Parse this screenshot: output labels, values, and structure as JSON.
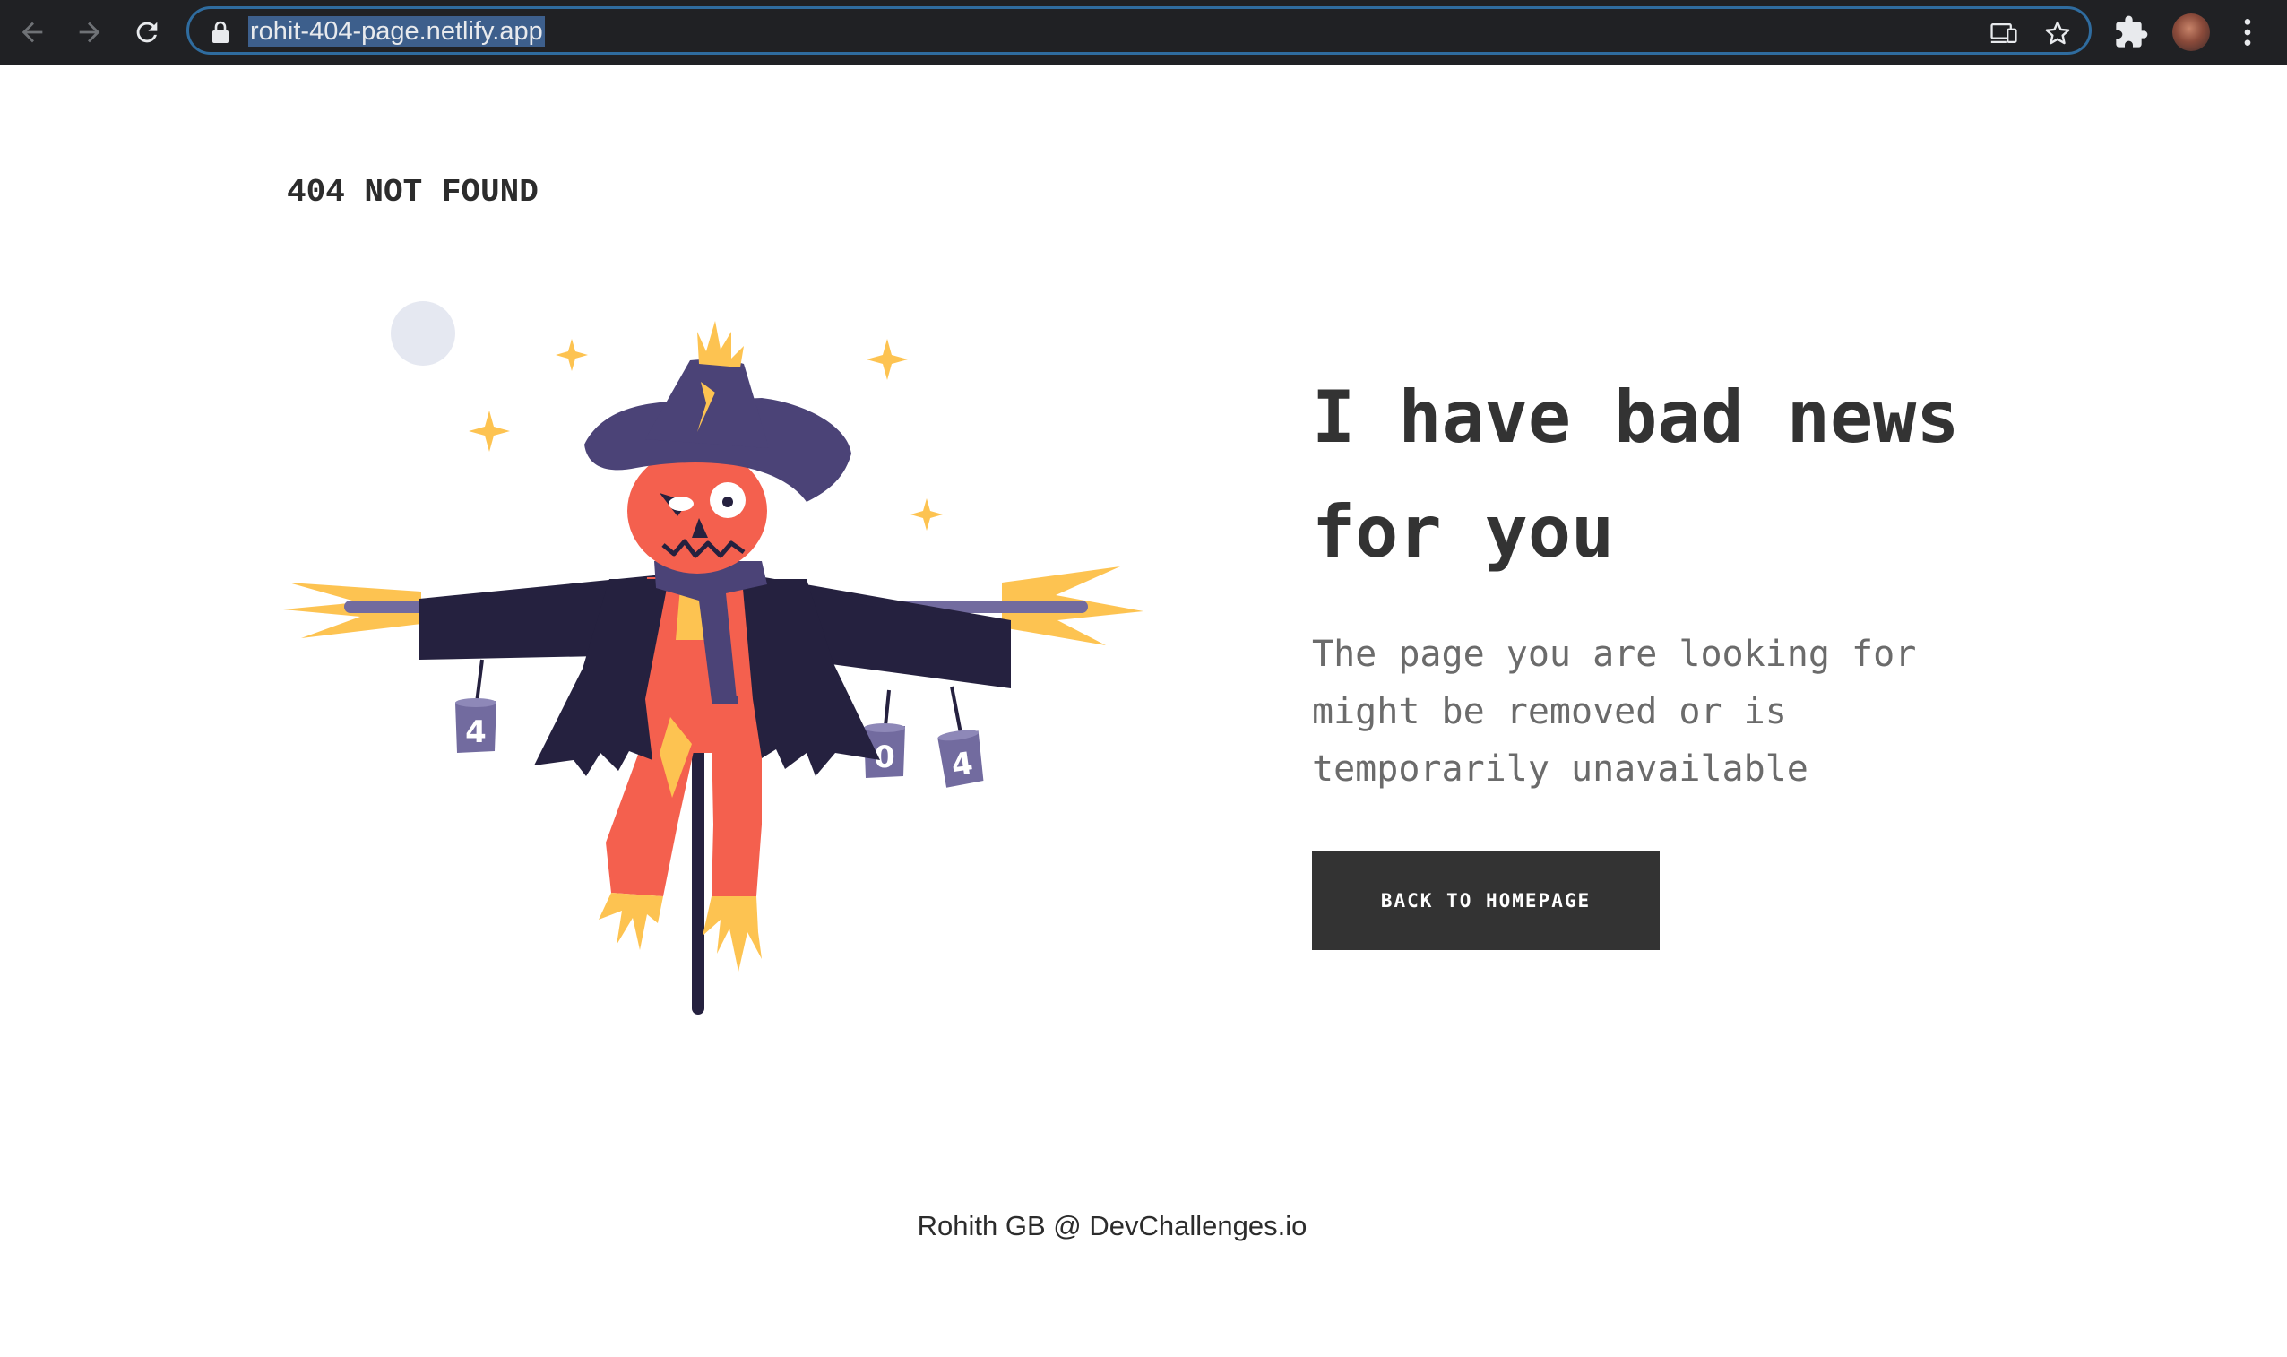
{
  "browser": {
    "url": "rohit-404-page.netlify.app",
    "icons": {
      "back": "back-arrow-icon",
      "forward": "forward-arrow-icon",
      "reload": "reload-icon",
      "lock": "lock-icon",
      "cast": "cast-icon",
      "bookmark": "bookmark-star-icon",
      "extensions": "puzzle-piece-icon",
      "menu": "kebab-menu-icon"
    },
    "colors": {
      "chrome_bg": "#202124",
      "omnibox_border": "#2f6c9f",
      "url_highlight": "#3d5f8c"
    }
  },
  "page": {
    "brand": "404 NOT FOUND",
    "headline_line1": "I have bad news",
    "headline_line2": "for you",
    "description_line1": "The page you are looking for",
    "description_line2": "might be removed or is",
    "description_line3": "temporarily unavailable",
    "button_label": "BACK TO HOMEPAGE",
    "footer": "Rohith GB @ DevChallenges.io",
    "illustration": {
      "subject": "scarecrow",
      "can_labels": [
        "4",
        "0",
        "4"
      ]
    },
    "colors": {
      "text_dark": "#333333",
      "text_muted": "#6b6b6b",
      "button_bg": "#333333",
      "button_text": "#ffffff",
      "coat": "#25213f",
      "hat": "#4b4377",
      "face": "#f4604e",
      "straw": "#fdc351",
      "can": "#726b9f",
      "moon": "#e5e8f1"
    }
  }
}
